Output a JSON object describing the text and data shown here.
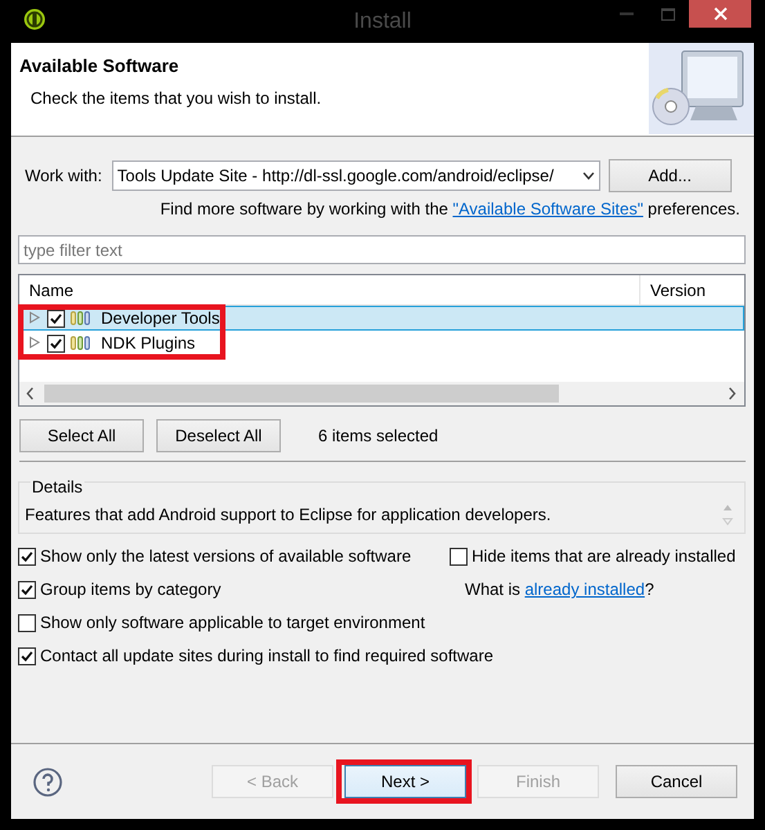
{
  "window": {
    "title": "Install"
  },
  "header": {
    "title": "Available Software",
    "description": "Check the items that you wish to install."
  },
  "work_with": {
    "label": "Work with:",
    "value": "Tools Update Site - http://dl-ssl.google.com/android/eclipse/",
    "add_button": "Add..."
  },
  "hint": {
    "before": "Find more software by working with the ",
    "link": "\"Available Software Sites\"",
    "after": " preferences."
  },
  "filter": {
    "placeholder": "type filter text"
  },
  "tree": {
    "columns": [
      "Name",
      "Version"
    ],
    "highlighted": true,
    "rows": [
      {
        "name": "Developer Tools",
        "checked": true,
        "selected": true,
        "expanded": false
      },
      {
        "name": "NDK Plugins",
        "checked": true,
        "selected": false,
        "expanded": false
      }
    ]
  },
  "selection": {
    "buttons": [
      "Select All",
      "Deselect All"
    ],
    "count": "6 items selected"
  },
  "details": {
    "title": "Details",
    "text": "Features that add Android support to Eclipse for application developers."
  },
  "options_left": [
    {
      "label": "Show only the latest versions of available software",
      "checked": true
    },
    {
      "label": "Group items by category",
      "checked": true
    },
    {
      "label": "Show only software applicable to target environment",
      "checked": false
    },
    {
      "label": "Contact all update sites during install to find required software",
      "checked": true
    }
  ],
  "options_right": [
    {
      "label": "Hide items that are already installed",
      "checked": false
    }
  ],
  "installed_hint": {
    "before": "What is ",
    "link": "already installed",
    "after": "?"
  },
  "footer": {
    "buttons": [
      {
        "label": "< Back",
        "disabled": true,
        "highlighted": false
      },
      {
        "label": "Next >",
        "disabled": false,
        "highlighted": true
      },
      {
        "label": "Finish",
        "disabled": true,
        "highlighted": false
      },
      {
        "label": "Cancel",
        "disabled": false,
        "highlighted": false
      }
    ]
  }
}
